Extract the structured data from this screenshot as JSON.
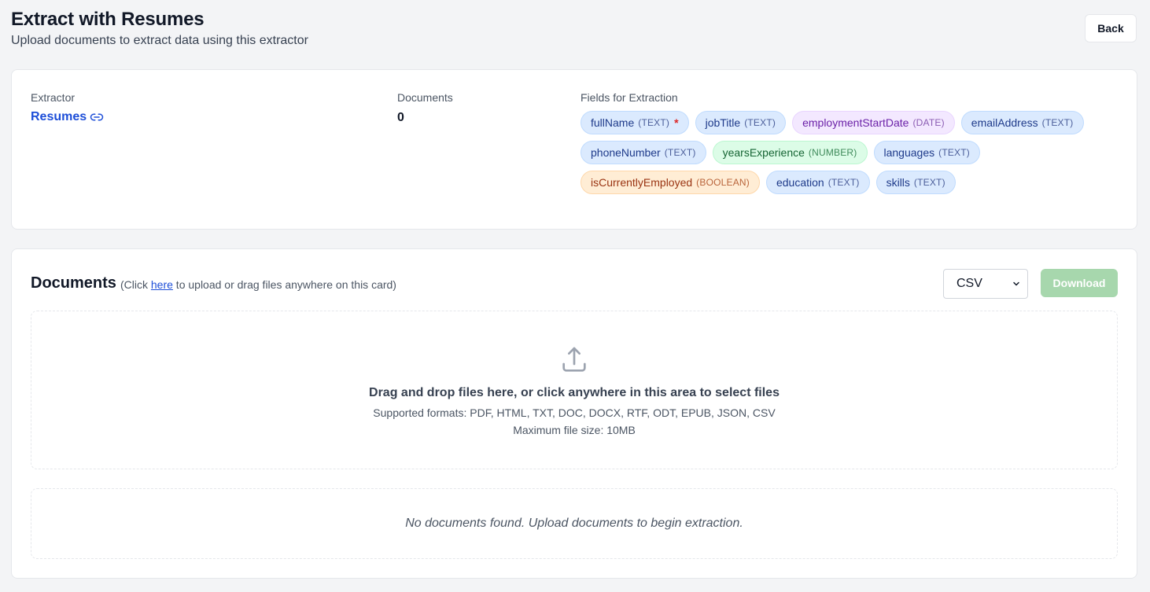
{
  "header": {
    "title": "Extract with Resumes",
    "subtitle": "Upload documents to extract data using this extractor",
    "back_label": "Back"
  },
  "info": {
    "extractor_label": "Extractor",
    "extractor_name": "Resumes",
    "documents_label": "Documents",
    "documents_count": "0",
    "fields_label": "Fields for Extraction",
    "fields": [
      {
        "name": "fullName",
        "type": "(TEXT)",
        "kind": "text",
        "required": true
      },
      {
        "name": "jobTitle",
        "type": "(TEXT)",
        "kind": "text",
        "required": false
      },
      {
        "name": "employmentStartDate",
        "type": "(DATE)",
        "kind": "date",
        "required": false
      },
      {
        "name": "emailAddress",
        "type": "(TEXT)",
        "kind": "text",
        "required": false
      },
      {
        "name": "phoneNumber",
        "type": "(TEXT)",
        "kind": "text",
        "required": false
      },
      {
        "name": "yearsExperience",
        "type": "(NUMBER)",
        "kind": "number",
        "required": false
      },
      {
        "name": "languages",
        "type": "(TEXT)",
        "kind": "text",
        "required": false
      },
      {
        "name": "isCurrentlyEmployed",
        "type": "(BOOLEAN)",
        "kind": "boolean",
        "required": false
      },
      {
        "name": "education",
        "type": "(TEXT)",
        "kind": "text",
        "required": false
      },
      {
        "name": "skills",
        "type": "(TEXT)",
        "kind": "text",
        "required": false
      }
    ],
    "required_marker": "*"
  },
  "documents": {
    "title": "Documents",
    "hint_prefix": "(Click ",
    "hint_link": "here",
    "hint_suffix": " to upload or drag files anywhere on this card)",
    "format_selected": "CSV",
    "download_label": "Download",
    "dropzone": {
      "main": "Drag and drop files here, or click anywhere in this area to select files",
      "formats": "Supported formats: PDF, HTML, TXT, DOC, DOCX, RTF, ODT, EPUB, JSON, CSV",
      "max_size": "Maximum file size: 10MB"
    },
    "empty_message": "No documents found. Upload documents to begin extraction."
  },
  "icons": {
    "link": "link-icon",
    "upload": "upload-icon",
    "chevron": "chevron-down-icon"
  }
}
